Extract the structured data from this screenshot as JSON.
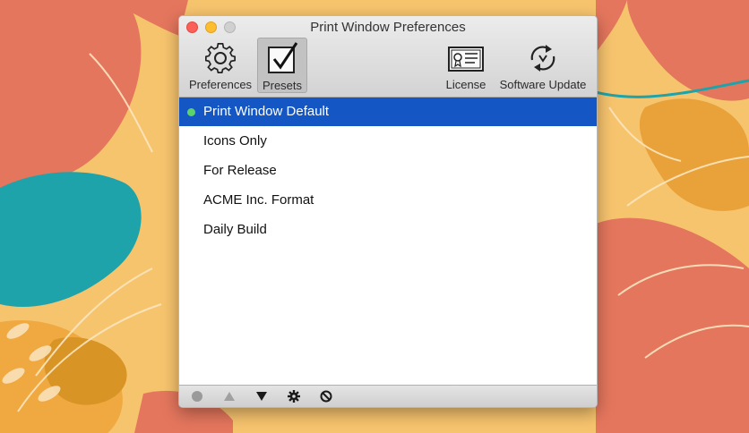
{
  "window": {
    "title": "Print Window Preferences"
  },
  "toolbar": {
    "items": [
      {
        "label": "Preferences",
        "icon": "gear-icon",
        "selected": false
      },
      {
        "label": "Presets",
        "icon": "checkbox-icon",
        "selected": true
      },
      {
        "label": "License",
        "icon": "license-card-icon",
        "selected": false
      },
      {
        "label": "Software Update",
        "icon": "update-sync-icon",
        "selected": false
      }
    ]
  },
  "presets": {
    "items": [
      {
        "label": "Print Window Default",
        "selected": true,
        "active": true
      },
      {
        "label": "Icons Only",
        "selected": false,
        "active": false
      },
      {
        "label": "For Release",
        "selected": false,
        "active": false
      },
      {
        "label": "ACME Inc. Format",
        "selected": false,
        "active": false
      },
      {
        "label": "Daily Build",
        "selected": false,
        "active": false
      }
    ]
  },
  "bottom_bar": {
    "buttons": [
      "set-default-dot-icon",
      "move-up-icon",
      "move-down-icon",
      "gear-icon",
      "delete-icon"
    ]
  },
  "colors": {
    "selection": "#1456c4",
    "active_dot": "#5bd36a"
  }
}
